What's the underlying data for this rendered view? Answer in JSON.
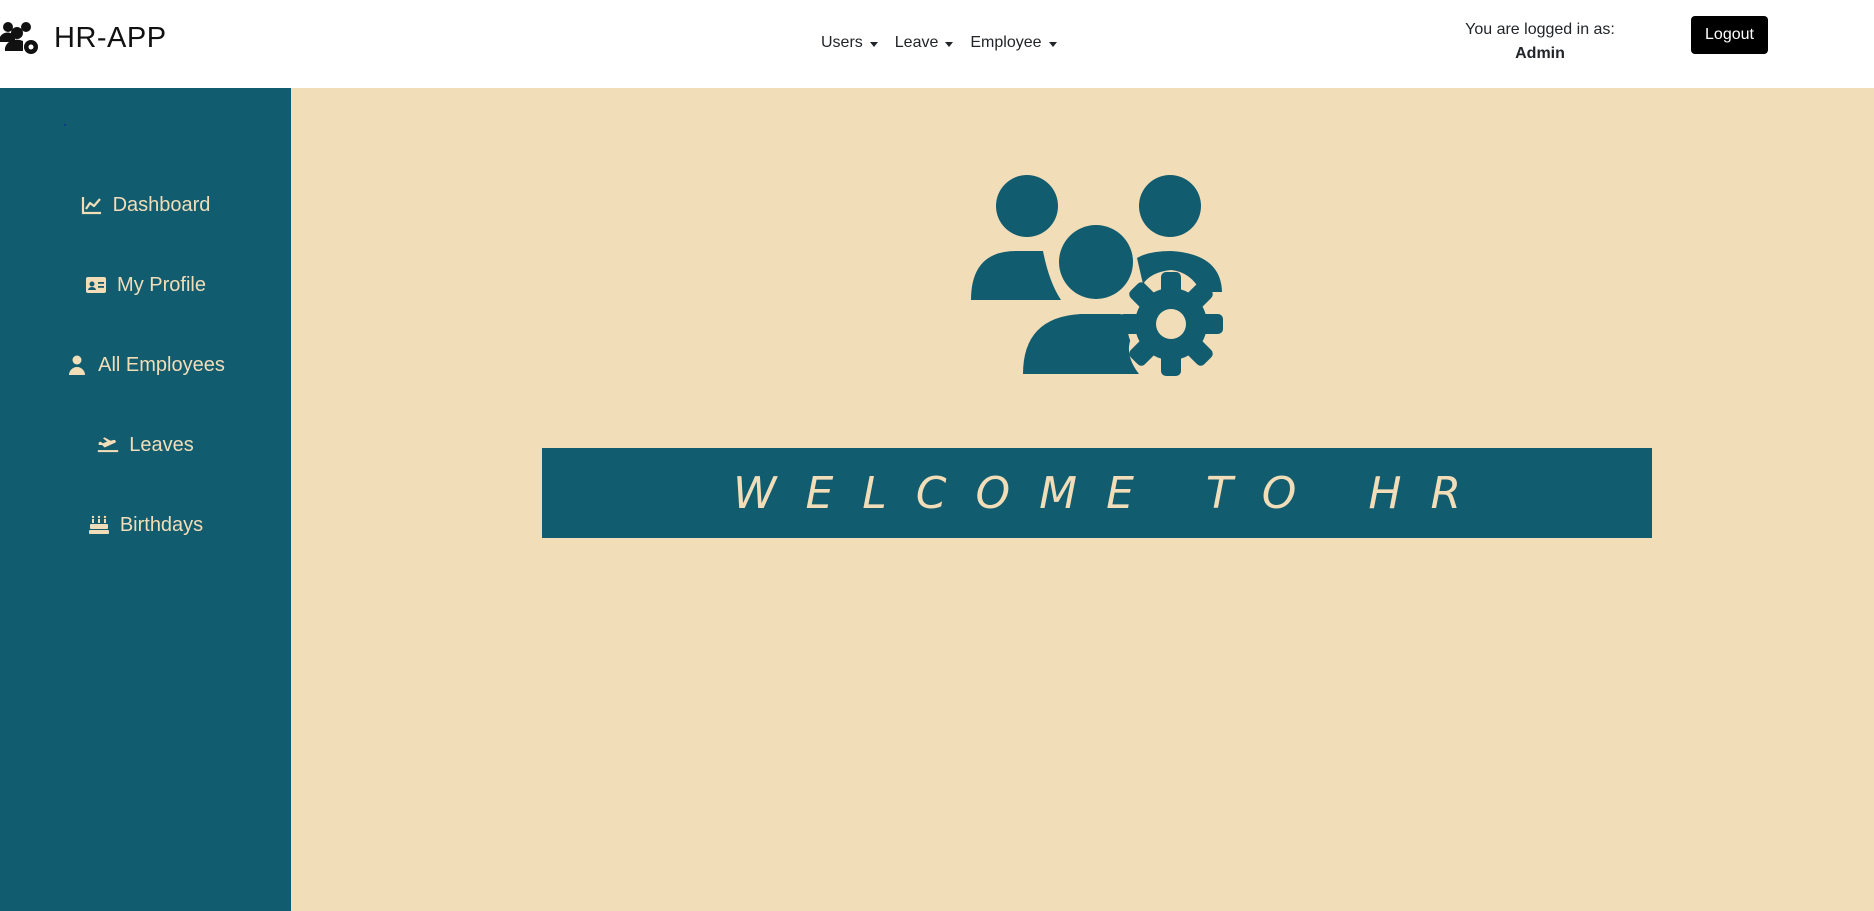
{
  "app": {
    "brand": "HR-APP",
    "brand_icon": "users-gear-icon"
  },
  "nav": {
    "menus": [
      {
        "label": "Users"
      },
      {
        "label": "Leave"
      },
      {
        "label": "Employee"
      }
    ]
  },
  "session": {
    "logged_in_label": "You are logged in as:",
    "username": "Admin",
    "logout_label": "Logout"
  },
  "sidebar": {
    "items": [
      {
        "label": "Dashboard",
        "icon": "chart-line-icon"
      },
      {
        "label": "My Profile",
        "icon": "id-card-icon"
      },
      {
        "label": "All Employees",
        "icon": "user-icon"
      },
      {
        "label": "Leaves",
        "icon": "plane-departure-icon"
      },
      {
        "label": "Birthdays",
        "icon": "cake-icon"
      }
    ]
  },
  "main": {
    "welcome_text": "WELCOME TO HR",
    "hero_icon": "users-gear-icon"
  },
  "colors": {
    "primary": "#115c6e",
    "cream": "#f2ddb9",
    "navbar_bg": "#ffffff",
    "logout_bg": "#000000"
  }
}
